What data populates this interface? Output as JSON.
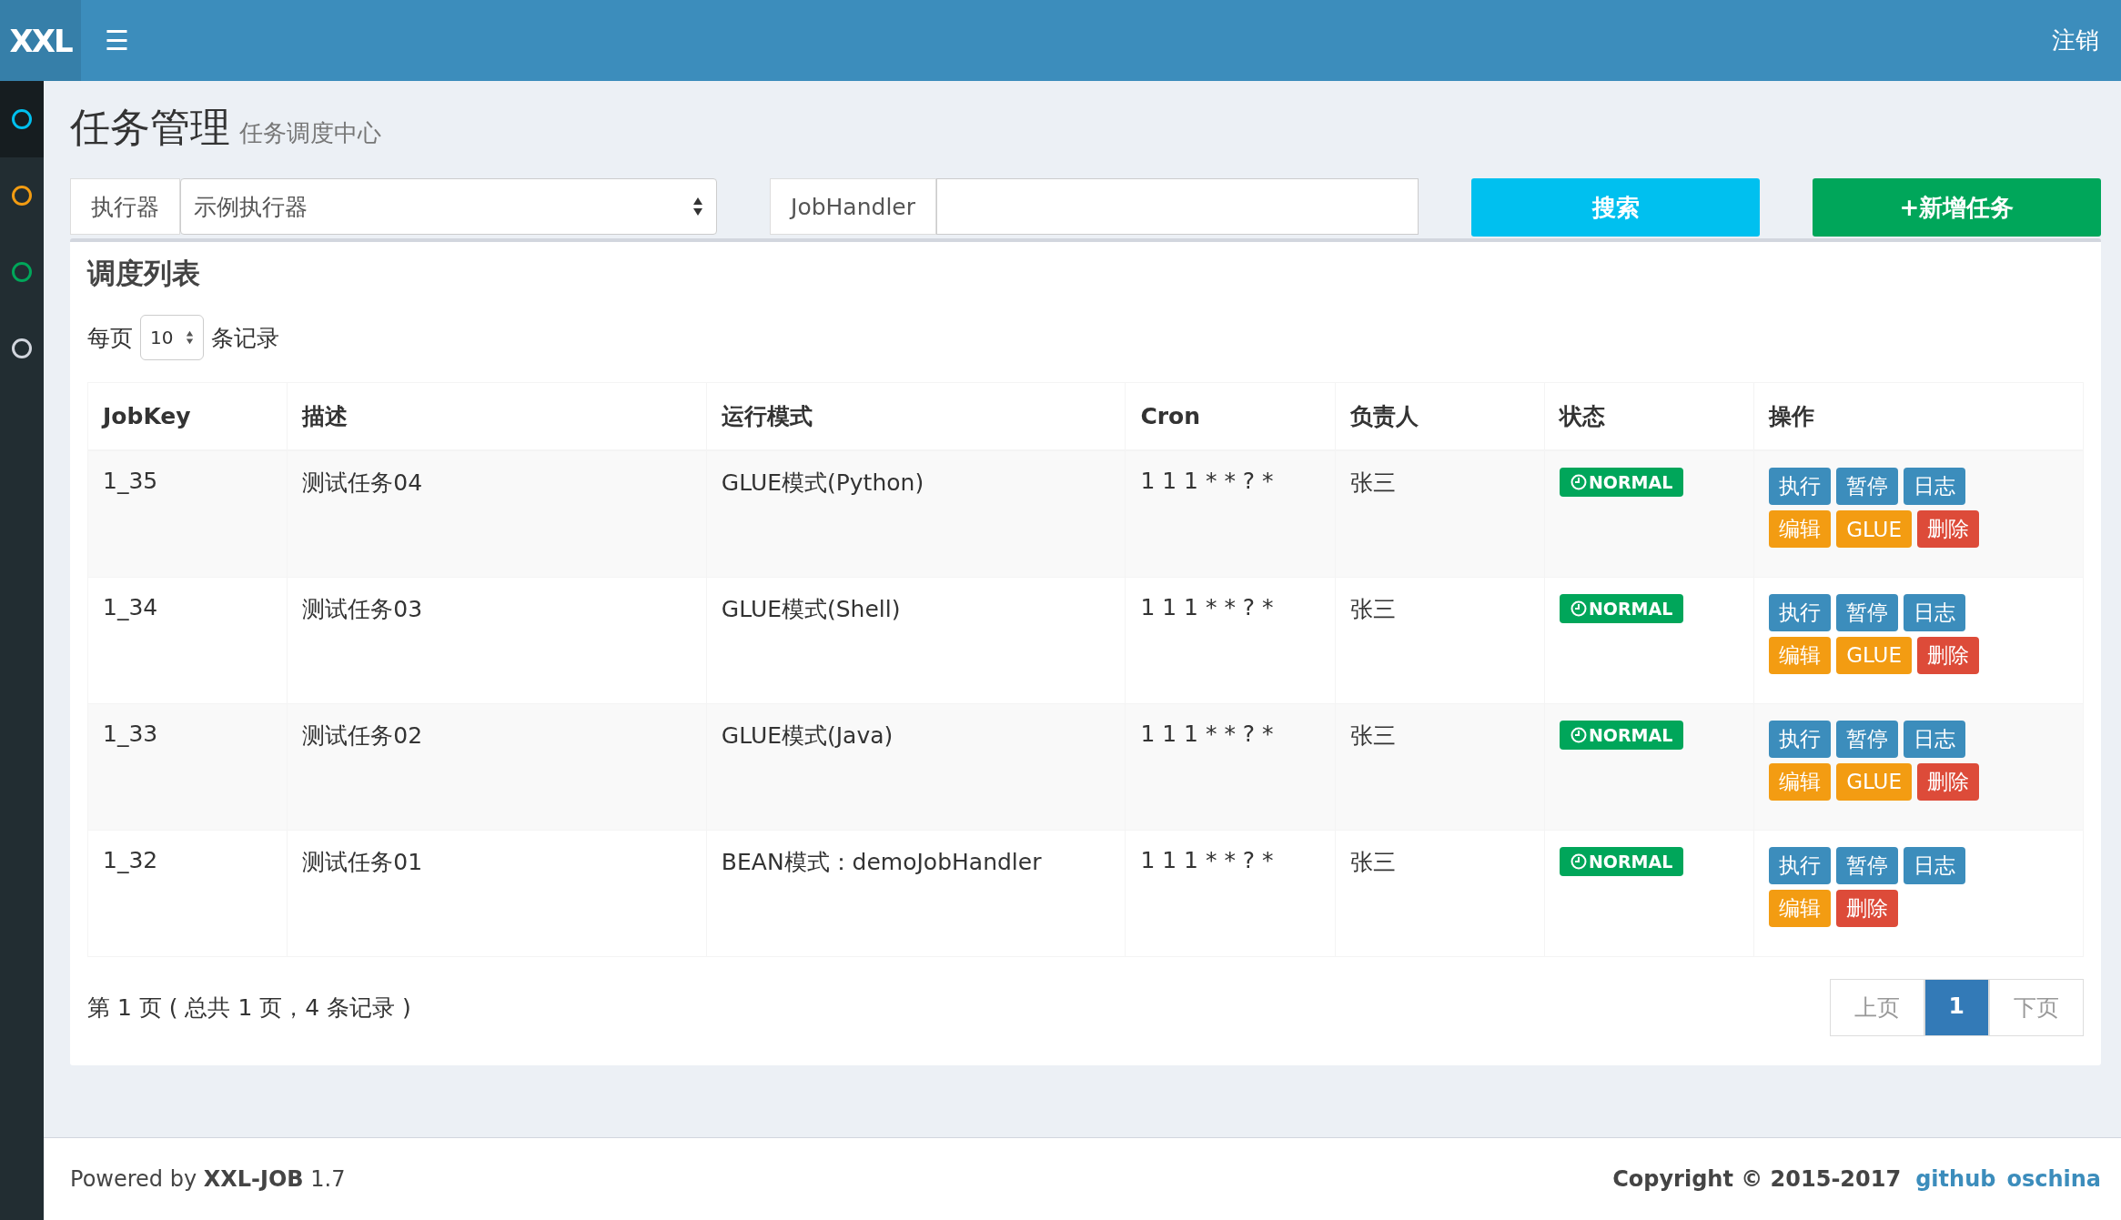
{
  "header": {
    "logo": "XXL",
    "menu_icon": "☰",
    "logout": "注销"
  },
  "sidebar": {
    "items": [
      {
        "color": "#00c0ef",
        "selected": true
      },
      {
        "color": "#f39c12",
        "selected": false
      },
      {
        "color": "#00a65a",
        "selected": false
      },
      {
        "color": "#d2d6de",
        "selected": false
      }
    ]
  },
  "page": {
    "title": "任务管理",
    "subtitle": "任务调度中心"
  },
  "filters": {
    "executor_label": "执行器",
    "executor_value": "示例执行器",
    "handler_label": "JobHandler",
    "search_button": "搜索",
    "add_button": "+新增任务"
  },
  "box": {
    "title": "调度列表",
    "page_size_prefix": "每页",
    "page_size": "10",
    "page_size_suffix": "条记录"
  },
  "table": {
    "columns": [
      "JobKey",
      "描述",
      "运行模式",
      "Cron",
      "负责人",
      "状态",
      "操作"
    ],
    "rows": [
      {
        "cells": [
          "1_35",
          "测试任务04",
          "GLUE模式(Python)",
          "1 1 1 * * ? *",
          "张三"
        ],
        "status": "NORMAL",
        "actions": [
          {
            "label": "执行",
            "kind": "primary"
          },
          {
            "label": "暂停",
            "kind": "primary"
          },
          {
            "label": "日志",
            "kind": "primary"
          },
          {
            "label": "编辑",
            "kind": "warning"
          },
          {
            "label": "GLUE",
            "kind": "warning"
          },
          {
            "label": "删除",
            "kind": "danger"
          }
        ]
      },
      {
        "cells": [
          "1_34",
          "测试任务03",
          "GLUE模式(Shell)",
          "1 1 1 * * ? *",
          "张三"
        ],
        "status": "NORMAL",
        "actions": [
          {
            "label": "执行",
            "kind": "primary"
          },
          {
            "label": "暂停",
            "kind": "primary"
          },
          {
            "label": "日志",
            "kind": "primary"
          },
          {
            "label": "编辑",
            "kind": "warning"
          },
          {
            "label": "GLUE",
            "kind": "warning"
          },
          {
            "label": "删除",
            "kind": "danger"
          }
        ]
      },
      {
        "cells": [
          "1_33",
          "测试任务02",
          "GLUE模式(Java)",
          "1 1 1 * * ? *",
          "张三"
        ],
        "status": "NORMAL",
        "actions": [
          {
            "label": "执行",
            "kind": "primary"
          },
          {
            "label": "暂停",
            "kind": "primary"
          },
          {
            "label": "日志",
            "kind": "primary"
          },
          {
            "label": "编辑",
            "kind": "warning"
          },
          {
            "label": "GLUE",
            "kind": "warning"
          },
          {
            "label": "删除",
            "kind": "danger"
          }
        ]
      },
      {
        "cells": [
          "1_32",
          "测试任务01",
          "BEAN模式：demoJobHandler",
          "1 1 1 * * ? *",
          "张三"
        ],
        "status": "NORMAL",
        "actions": [
          {
            "label": "执行",
            "kind": "primary"
          },
          {
            "label": "暂停",
            "kind": "primary"
          },
          {
            "label": "日志",
            "kind": "primary"
          },
          {
            "label": "编辑",
            "kind": "warning"
          },
          {
            "label": "删除",
            "kind": "danger"
          }
        ]
      }
    ]
  },
  "table_info": "第 1 页 ( 总共 1 页，4 条记录 )",
  "pagination": [
    {
      "label": "上页",
      "selected": false
    },
    {
      "label": "1",
      "selected": true
    },
    {
      "label": "下页",
      "selected": false
    }
  ],
  "footer": {
    "powered": "Powered by **XXL-JOB** 1.7",
    "copyright": "Copyright © 2015-2017",
    "links": [
      "github",
      "oschina"
    ]
  }
}
